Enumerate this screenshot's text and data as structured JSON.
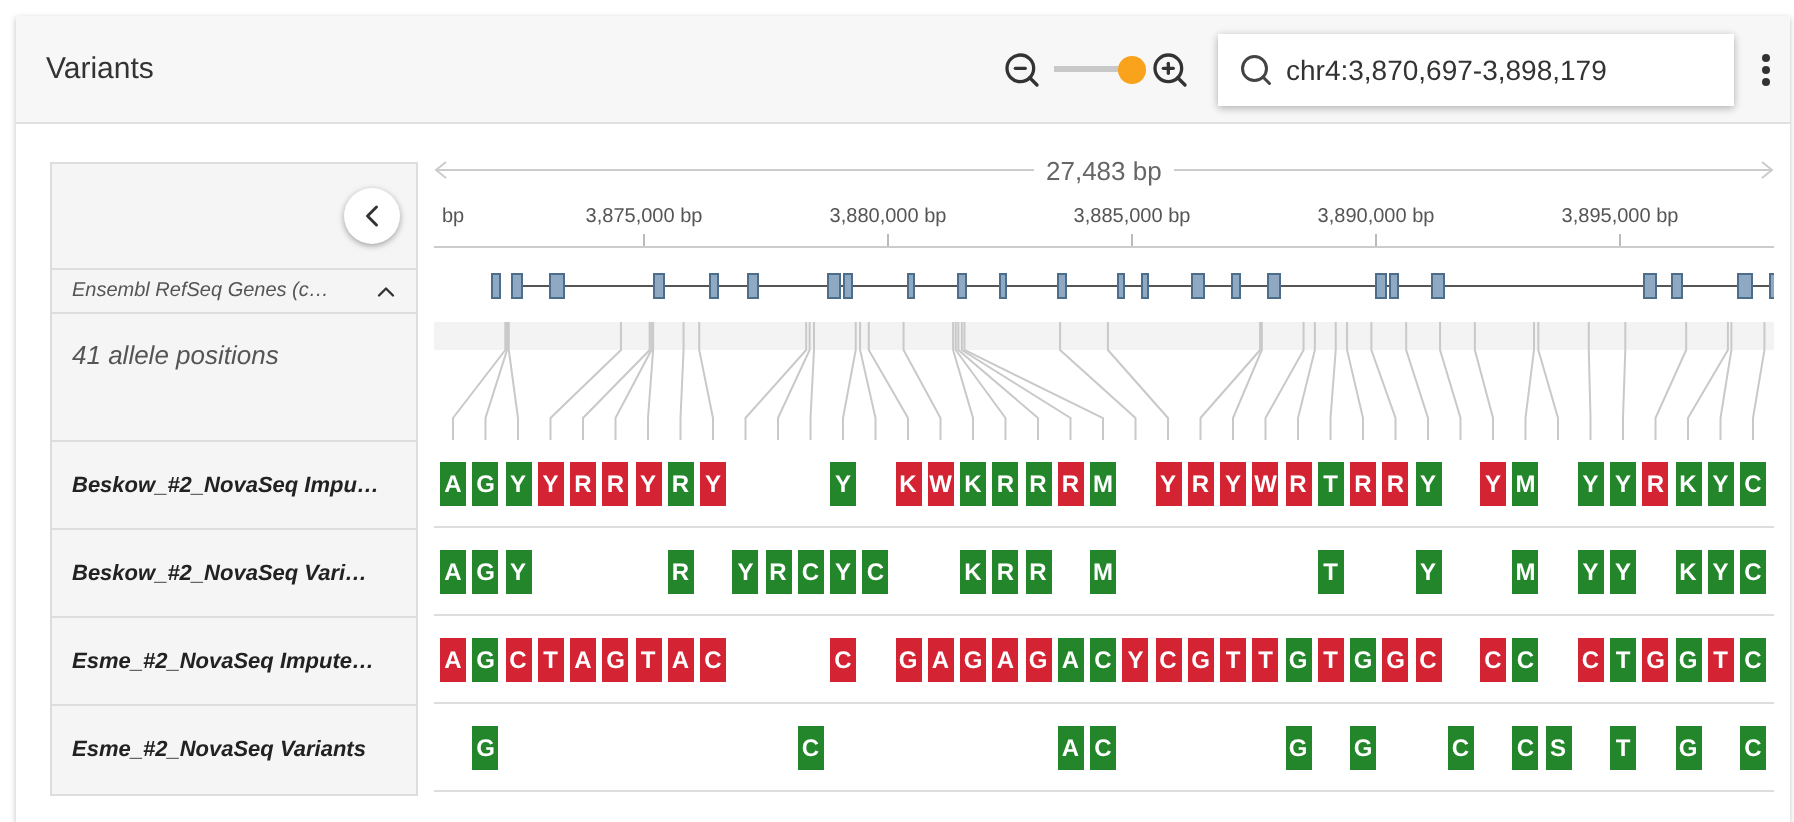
{
  "header": {
    "title": "Variants",
    "zoom_slider": {
      "level": 1
    },
    "search": {
      "value": "chr4:3,870,697-3,898,179"
    }
  },
  "ruler": {
    "span": "27,483 bp",
    "edge_label": "bp",
    "ticks": [
      "3,875,000 bp",
      "3,880,000 bp",
      "3,885,000 bp",
      "3,890,000 bp",
      "3,895,000 bp"
    ]
  },
  "gene_track": {
    "label": "Ensembl RefSeq Genes (c…",
    "expanded": true
  },
  "allele_summary": "41 allele positions",
  "samples": [
    {
      "name": "Beskow_#2_NovaSeq Impu…",
      "alleles": [
        {
          "kind": "allele",
          "base": "A",
          "color": "#23862a"
        },
        {
          "kind": "allele",
          "base": "G",
          "color": "#23862a"
        },
        {
          "kind": "allele",
          "base": "Y",
          "color": "#23862a"
        },
        {
          "kind": "allele",
          "base": "Y",
          "color": "#d42332"
        },
        {
          "kind": "allele",
          "base": "R",
          "color": "#d42332"
        },
        {
          "kind": "allele",
          "base": "R",
          "color": "#d42332"
        },
        {
          "kind": "allele",
          "base": "Y",
          "color": "#d42332"
        },
        {
          "kind": "allele",
          "base": "R",
          "color": "#23862a"
        },
        {
          "kind": "allele",
          "base": "Y",
          "color": "#d42332"
        },
        {
          "kind": "gap"
        },
        {
          "kind": "gap"
        },
        {
          "kind": "gap"
        },
        {
          "kind": "allele",
          "base": "Y",
          "color": "#23862a"
        },
        {
          "kind": "gap"
        },
        {
          "kind": "allele",
          "base": "K",
          "color": "#d42332"
        },
        {
          "kind": "allele",
          "base": "W",
          "color": "#d42332"
        },
        {
          "kind": "allele",
          "base": "K",
          "color": "#23862a"
        },
        {
          "kind": "allele",
          "base": "R",
          "color": "#23862a"
        },
        {
          "kind": "allele",
          "base": "R",
          "color": "#23862a"
        },
        {
          "kind": "allele",
          "base": "R",
          "color": "#d42332"
        },
        {
          "kind": "allele",
          "base": "M",
          "color": "#23862a"
        },
        {
          "kind": "gap"
        },
        {
          "kind": "allele",
          "base": "Y",
          "color": "#d42332"
        },
        {
          "kind": "allele",
          "base": "R",
          "color": "#d42332"
        },
        {
          "kind": "allele",
          "base": "Y",
          "color": "#d42332"
        },
        {
          "kind": "allele",
          "base": "W",
          "color": "#d42332"
        },
        {
          "kind": "allele",
          "base": "R",
          "color": "#d42332"
        },
        {
          "kind": "allele",
          "base": "T",
          "color": "#23862a"
        },
        {
          "kind": "allele",
          "base": "R",
          "color": "#d42332"
        },
        {
          "kind": "allele",
          "base": "R",
          "color": "#d42332"
        },
        {
          "kind": "allele",
          "base": "Y",
          "color": "#23862a"
        },
        {
          "kind": "gap"
        },
        {
          "kind": "allele",
          "base": "Y",
          "color": "#d42332"
        },
        {
          "kind": "allele",
          "base": "M",
          "color": "#23862a"
        },
        {
          "kind": "gap"
        },
        {
          "kind": "allele",
          "base": "Y",
          "color": "#23862a"
        },
        {
          "kind": "allele",
          "base": "Y",
          "color": "#23862a"
        },
        {
          "kind": "allele",
          "base": "R",
          "color": "#d42332"
        },
        {
          "kind": "allele",
          "base": "K",
          "color": "#23862a"
        },
        {
          "kind": "allele",
          "base": "Y",
          "color": "#23862a"
        },
        {
          "kind": "allele",
          "base": "C",
          "color": "#23862a"
        }
      ]
    },
    {
      "name": "Beskow_#2_NovaSeq Vari…",
      "alleles": [
        {
          "kind": "allele",
          "base": "A",
          "color": "#23862a"
        },
        {
          "kind": "allele",
          "base": "G",
          "color": "#23862a"
        },
        {
          "kind": "allele",
          "base": "Y",
          "color": "#23862a"
        },
        {
          "kind": "gap"
        },
        {
          "kind": "gap"
        },
        {
          "kind": "gap"
        },
        {
          "kind": "gap"
        },
        {
          "kind": "allele",
          "base": "R",
          "color": "#23862a"
        },
        {
          "kind": "gap"
        },
        {
          "kind": "allele",
          "base": "Y",
          "color": "#23862a"
        },
        {
          "kind": "allele",
          "base": "R",
          "color": "#23862a"
        },
        {
          "kind": "allele",
          "base": "C",
          "color": "#23862a"
        },
        {
          "kind": "allele",
          "base": "Y",
          "color": "#23862a"
        },
        {
          "kind": "allele",
          "base": "C",
          "color": "#23862a"
        },
        {
          "kind": "gap"
        },
        {
          "kind": "gap"
        },
        {
          "kind": "allele",
          "base": "K",
          "color": "#23862a"
        },
        {
          "kind": "allele",
          "base": "R",
          "color": "#23862a"
        },
        {
          "kind": "allele",
          "base": "R",
          "color": "#23862a"
        },
        {
          "kind": "gap"
        },
        {
          "kind": "allele",
          "base": "M",
          "color": "#23862a"
        },
        {
          "kind": "gap"
        },
        {
          "kind": "gap"
        },
        {
          "kind": "gap"
        },
        {
          "kind": "gap"
        },
        {
          "kind": "gap"
        },
        {
          "kind": "gap"
        },
        {
          "kind": "allele",
          "base": "T",
          "color": "#23862a"
        },
        {
          "kind": "gap"
        },
        {
          "kind": "gap"
        },
        {
          "kind": "allele",
          "base": "Y",
          "color": "#23862a"
        },
        {
          "kind": "gap"
        },
        {
          "kind": "gap"
        },
        {
          "kind": "allele",
          "base": "M",
          "color": "#23862a"
        },
        {
          "kind": "gap"
        },
        {
          "kind": "allele",
          "base": "Y",
          "color": "#23862a"
        },
        {
          "kind": "allele",
          "base": "Y",
          "color": "#23862a"
        },
        {
          "kind": "gap"
        },
        {
          "kind": "allele",
          "base": "K",
          "color": "#23862a"
        },
        {
          "kind": "allele",
          "base": "Y",
          "color": "#23862a"
        },
        {
          "kind": "allele",
          "base": "C",
          "color": "#23862a"
        }
      ]
    },
    {
      "name": "Esme_#2_NovaSeq Impute…",
      "alleles": [
        {
          "kind": "allele",
          "base": "A",
          "color": "#d42332"
        },
        {
          "kind": "allele",
          "base": "G",
          "color": "#23862a"
        },
        {
          "kind": "allele",
          "base": "C",
          "color": "#d42332"
        },
        {
          "kind": "allele",
          "base": "T",
          "color": "#d42332"
        },
        {
          "kind": "allele",
          "base": "A",
          "color": "#d42332"
        },
        {
          "kind": "allele",
          "base": "G",
          "color": "#d42332"
        },
        {
          "kind": "allele",
          "base": "T",
          "color": "#d42332"
        },
        {
          "kind": "allele",
          "base": "A",
          "color": "#d42332"
        },
        {
          "kind": "allele",
          "base": "C",
          "color": "#d42332"
        },
        {
          "kind": "gap"
        },
        {
          "kind": "gap"
        },
        {
          "kind": "gap"
        },
        {
          "kind": "allele",
          "base": "C",
          "color": "#d42332"
        },
        {
          "kind": "gap"
        },
        {
          "kind": "allele",
          "base": "G",
          "color": "#d42332"
        },
        {
          "kind": "allele",
          "base": "A",
          "color": "#d42332"
        },
        {
          "kind": "allele",
          "base": "G",
          "color": "#d42332"
        },
        {
          "kind": "allele",
          "base": "A",
          "color": "#d42332"
        },
        {
          "kind": "allele",
          "base": "G",
          "color": "#d42332"
        },
        {
          "kind": "allele",
          "base": "A",
          "color": "#23862a"
        },
        {
          "kind": "allele",
          "base": "C",
          "color": "#23862a"
        },
        {
          "kind": "allele",
          "base": "Y",
          "color": "#d42332"
        },
        {
          "kind": "allele",
          "base": "C",
          "color": "#d42332"
        },
        {
          "kind": "allele",
          "base": "G",
          "color": "#d42332"
        },
        {
          "kind": "allele",
          "base": "T",
          "color": "#d42332"
        },
        {
          "kind": "allele",
          "base": "T",
          "color": "#d42332"
        },
        {
          "kind": "allele",
          "base": "G",
          "color": "#23862a"
        },
        {
          "kind": "allele",
          "base": "T",
          "color": "#d42332"
        },
        {
          "kind": "allele",
          "base": "G",
          "color": "#23862a"
        },
        {
          "kind": "allele",
          "base": "G",
          "color": "#d42332"
        },
        {
          "kind": "allele",
          "base": "C",
          "color": "#d42332"
        },
        {
          "kind": "gap"
        },
        {
          "kind": "allele",
          "base": "C",
          "color": "#d42332"
        },
        {
          "kind": "allele",
          "base": "C",
          "color": "#23862a"
        },
        {
          "kind": "gap"
        },
        {
          "kind": "allele",
          "base": "C",
          "color": "#d42332"
        },
        {
          "kind": "allele",
          "base": "T",
          "color": "#23862a"
        },
        {
          "kind": "allele",
          "base": "G",
          "color": "#d42332"
        },
        {
          "kind": "allele",
          "base": "G",
          "color": "#23862a"
        },
        {
          "kind": "allele",
          "base": "T",
          "color": "#d42332"
        },
        {
          "kind": "allele",
          "base": "C",
          "color": "#23862a"
        }
      ]
    },
    {
      "name": "Esme_#2_NovaSeq Variants",
      "alleles": [
        {
          "kind": "gap"
        },
        {
          "kind": "allele",
          "base": "G",
          "color": "#23862a"
        },
        {
          "kind": "gap"
        },
        {
          "kind": "gap"
        },
        {
          "kind": "gap"
        },
        {
          "kind": "gap"
        },
        {
          "kind": "gap"
        },
        {
          "kind": "gap"
        },
        {
          "kind": "gap"
        },
        {
          "kind": "gap"
        },
        {
          "kind": "gap"
        },
        {
          "kind": "allele",
          "base": "C",
          "color": "#23862a"
        },
        {
          "kind": "gap"
        },
        {
          "kind": "gap"
        },
        {
          "kind": "gap"
        },
        {
          "kind": "gap"
        },
        {
          "kind": "gap"
        },
        {
          "kind": "gap"
        },
        {
          "kind": "gap"
        },
        {
          "kind": "allele",
          "base": "A",
          "color": "#23862a"
        },
        {
          "kind": "allele",
          "base": "C",
          "color": "#23862a"
        },
        {
          "kind": "gap"
        },
        {
          "kind": "gap"
        },
        {
          "kind": "gap"
        },
        {
          "kind": "gap"
        },
        {
          "kind": "gap"
        },
        {
          "kind": "allele",
          "base": "G",
          "color": "#23862a"
        },
        {
          "kind": "gap"
        },
        {
          "kind": "allele",
          "base": "G",
          "color": "#23862a"
        },
        {
          "kind": "gap"
        },
        {
          "kind": "gap"
        },
        {
          "kind": "allele",
          "base": "C",
          "color": "#23862a"
        },
        {
          "kind": "gap"
        },
        {
          "kind": "allele",
          "base": "C",
          "color": "#23862a"
        },
        {
          "kind": "allele",
          "base": "S",
          "color": "#23862a"
        },
        {
          "kind": "gap"
        },
        {
          "kind": "allele",
          "base": "T",
          "color": "#23862a"
        },
        {
          "kind": "gap"
        },
        {
          "kind": "allele",
          "base": "G",
          "color": "#23862a"
        },
        {
          "kind": "gap"
        },
        {
          "kind": "allele",
          "base": "C",
          "color": "#23862a"
        }
      ]
    }
  ]
}
